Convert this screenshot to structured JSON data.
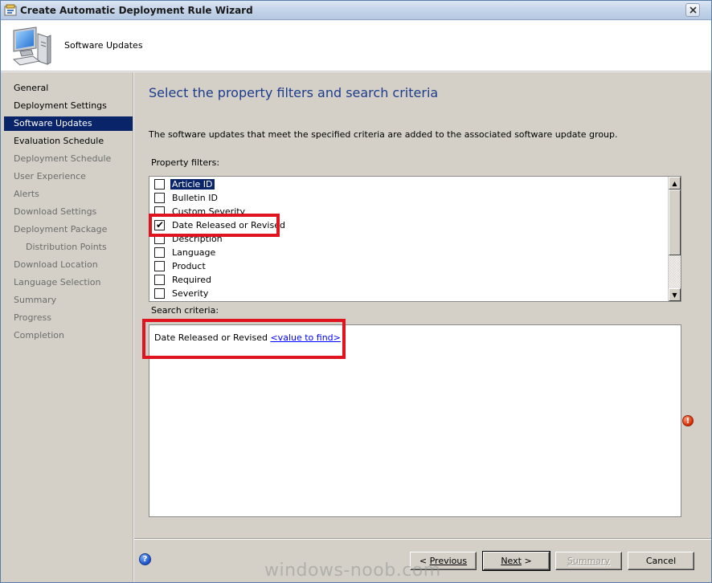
{
  "window": {
    "title": "Create Automatic Deployment Rule Wizard"
  },
  "header": {
    "title": "Software Updates",
    "icon": "computer-icon"
  },
  "nav": {
    "items": [
      {
        "label": "General",
        "state": "done"
      },
      {
        "label": "Deployment Settings",
        "state": "done"
      },
      {
        "label": "Software Updates",
        "state": "active"
      },
      {
        "label": "Evaluation Schedule",
        "state": "done"
      },
      {
        "label": "Deployment Schedule",
        "state": "pending"
      },
      {
        "label": "User Experience",
        "state": "pending"
      },
      {
        "label": "Alerts",
        "state": "pending"
      },
      {
        "label": "Download Settings",
        "state": "pending"
      },
      {
        "label": "Deployment Package",
        "state": "pending"
      },
      {
        "label": "Distribution Points",
        "state": "pending",
        "sub": true
      },
      {
        "label": "Download Location",
        "state": "pending"
      },
      {
        "label": "Language Selection",
        "state": "pending"
      },
      {
        "label": "Summary",
        "state": "pending"
      },
      {
        "label": "Progress",
        "state": "pending"
      },
      {
        "label": "Completion",
        "state": "pending"
      }
    ]
  },
  "main": {
    "heading": "Select the property filters and search criteria",
    "description": "The software updates that meet the specified criteria are added to the associated software update group.",
    "property_filters_label": "Property filters:",
    "property_filters": [
      {
        "label": "Article ID",
        "checked": false,
        "selected": true
      },
      {
        "label": "Bulletin ID",
        "checked": false,
        "selected": false
      },
      {
        "label": "Custom Severity",
        "checked": false,
        "selected": false
      },
      {
        "label": "Date Released or Revised",
        "checked": true,
        "selected": false
      },
      {
        "label": "Description",
        "checked": false,
        "selected": false
      },
      {
        "label": "Language",
        "checked": false,
        "selected": false
      },
      {
        "label": "Product",
        "checked": false,
        "selected": false
      },
      {
        "label": "Required",
        "checked": false,
        "selected": false
      },
      {
        "label": "Severity",
        "checked": false,
        "selected": false
      }
    ],
    "search_criteria_label": "Search criteria:",
    "search_criteria": {
      "property": "Date Released or Revised",
      "value_link": "<value to find>"
    }
  },
  "footer": {
    "previous_label": "Previous",
    "previous_prefix": "< ",
    "next_label": "Next",
    "next_suffix": " >",
    "summary_label": "Summary",
    "cancel_label": "Cancel"
  },
  "watermark": "windows-noob.com",
  "colors": {
    "highlight": "#e0141e",
    "nav_active": "#0a246a",
    "heading": "#1c3c8c",
    "link": "#0000ff"
  }
}
